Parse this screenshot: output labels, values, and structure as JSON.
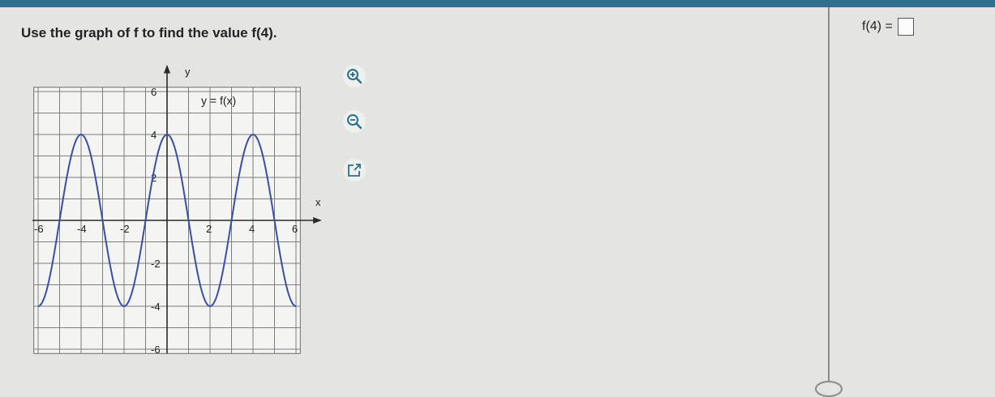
{
  "question": {
    "prompt": "Use the graph of f to find the value f(4).",
    "answer_label": "f(4) =",
    "answer_value": ""
  },
  "graph": {
    "curve_label": "y = f(x)",
    "x_axis_label": "x",
    "y_axis_label": "y"
  },
  "chart_data": {
    "type": "line",
    "title": "",
    "label": "y = f(x)",
    "x": [
      -6,
      -5,
      -4,
      -3,
      -2,
      -1,
      0,
      1,
      2,
      3,
      4,
      5,
      6
    ],
    "y": [
      -4,
      0,
      4,
      0,
      -4,
      0,
      4,
      0,
      -4,
      0,
      4,
      0,
      -4
    ],
    "xlim": [
      -6,
      6
    ],
    "ylim": [
      -6,
      6
    ],
    "x_ticks": [
      "-6",
      "-4",
      "-2",
      "2",
      "4",
      "6"
    ],
    "y_ticks": [
      "6",
      "4",
      "2",
      "-2",
      "-4",
      "-6"
    ],
    "grid": true,
    "line_color": "#3a4ea3"
  },
  "tools": [
    {
      "name": "zoom-in-icon"
    },
    {
      "name": "zoom-out-icon"
    },
    {
      "name": "popout-icon"
    }
  ]
}
